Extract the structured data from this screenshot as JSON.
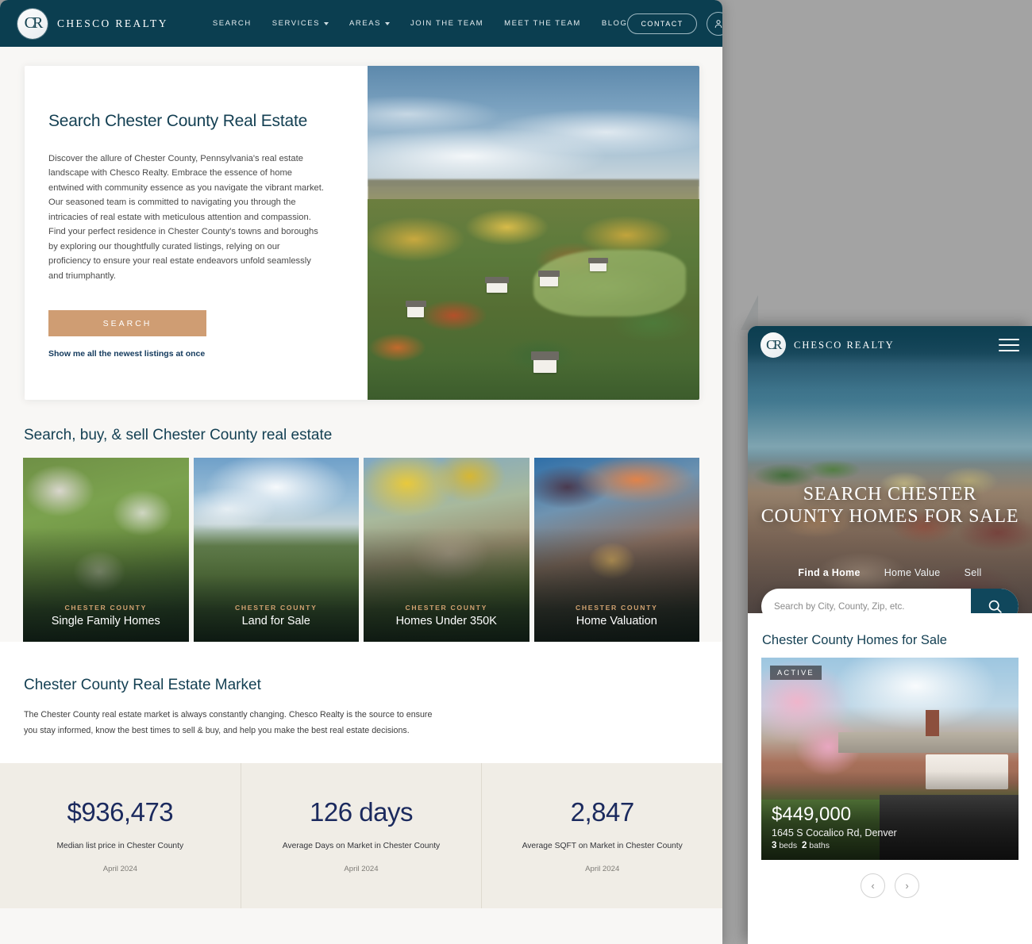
{
  "desktop": {
    "nav": {
      "logo_mark": "CR",
      "brand": "CHESCO REALTY",
      "links": [
        {
          "label": "SEARCH",
          "has_caret": false
        },
        {
          "label": "SERVICES",
          "has_caret": true
        },
        {
          "label": "AREAS",
          "has_caret": true
        },
        {
          "label": "JOIN THE TEAM",
          "has_caret": false
        },
        {
          "label": "MEET THE TEAM",
          "has_caret": false
        },
        {
          "label": "BLOG",
          "has_caret": false
        }
      ],
      "contact_label": "CONTACT",
      "account_icon": "user-icon"
    },
    "hero": {
      "title": "Search Chester County Real Estate",
      "body": "Discover the allure of Chester County, Pennsylvania's real estate landscape with Chesco Realty. Embrace the essence of home entwined with community essence as you navigate the vibrant market. Our seasoned team is committed to navigating you through the intricacies of real estate with meticulous attention and compassion. Find your perfect residence in Chester County's towns and boroughs by exploring our thoughtfully curated listings, relying on our proficiency to ensure your real estate endeavors unfold seamlessly and triumphantly.",
      "search_label": "SEARCH",
      "link_label": "Show me all the newest listings at once"
    },
    "categories": {
      "title": "Search, buy, & sell Chester County real estate",
      "cards": [
        {
          "eyebrow": "CHESTER COUNTY",
          "name": "Single Family Homes"
        },
        {
          "eyebrow": "CHESTER COUNTY",
          "name": "Land for Sale"
        },
        {
          "eyebrow": "CHESTER COUNTY",
          "name": "Homes Under 350K"
        },
        {
          "eyebrow": "CHESTER COUNTY",
          "name": "Home Valuation"
        }
      ]
    },
    "market": {
      "title": "Chester County Real Estate Market",
      "body": "The Chester County real estate market is always constantly changing. Chesco Realty is the source to ensure you stay informed, know the best times to sell & buy, and help you make the best real estate decisions.",
      "stats": [
        {
          "value": "$936,473",
          "label": "Median list price in Chester County",
          "date": "April 2024"
        },
        {
          "value": "126 days",
          "label": "Average Days on Market in Chester County",
          "date": "April 2024"
        },
        {
          "value": "2,847",
          "label": "Average SQFT on Market in Chester County",
          "date": "April 2024"
        }
      ]
    }
  },
  "mobile": {
    "nav": {
      "logo_mark": "CR",
      "brand": "CHESCO REALTY",
      "menu_icon": "hamburger-menu-icon"
    },
    "hero": {
      "title": "SEARCH CHESTER COUNTY HOMES FOR SALE",
      "tabs": [
        {
          "label": "Find a Home",
          "active": true
        },
        {
          "label": "Home Value",
          "active": false
        },
        {
          "label": "Sell",
          "active": false
        }
      ],
      "search_placeholder": "Search by City, County, Zip, etc.",
      "search_value": "",
      "search_icon": "search-icon"
    },
    "listings": {
      "title": "Chester County Homes for Sale",
      "card": {
        "status": "ACTIVE",
        "price": "$449,000",
        "address": "1645 S Cocalico Rd, Denver",
        "beds": "3",
        "beds_label": "beds",
        "baths": "2",
        "baths_label": "baths"
      },
      "prev_icon": "‹",
      "next_icon": "›"
    }
  },
  "colors": {
    "navy": "#0b3e50",
    "accent_tan": "#cf9d73",
    "heading": "#133f52",
    "stat_blue": "#1b2a5e",
    "stats_band": "#f0ede6",
    "page_bg": "#a3a3a3"
  }
}
